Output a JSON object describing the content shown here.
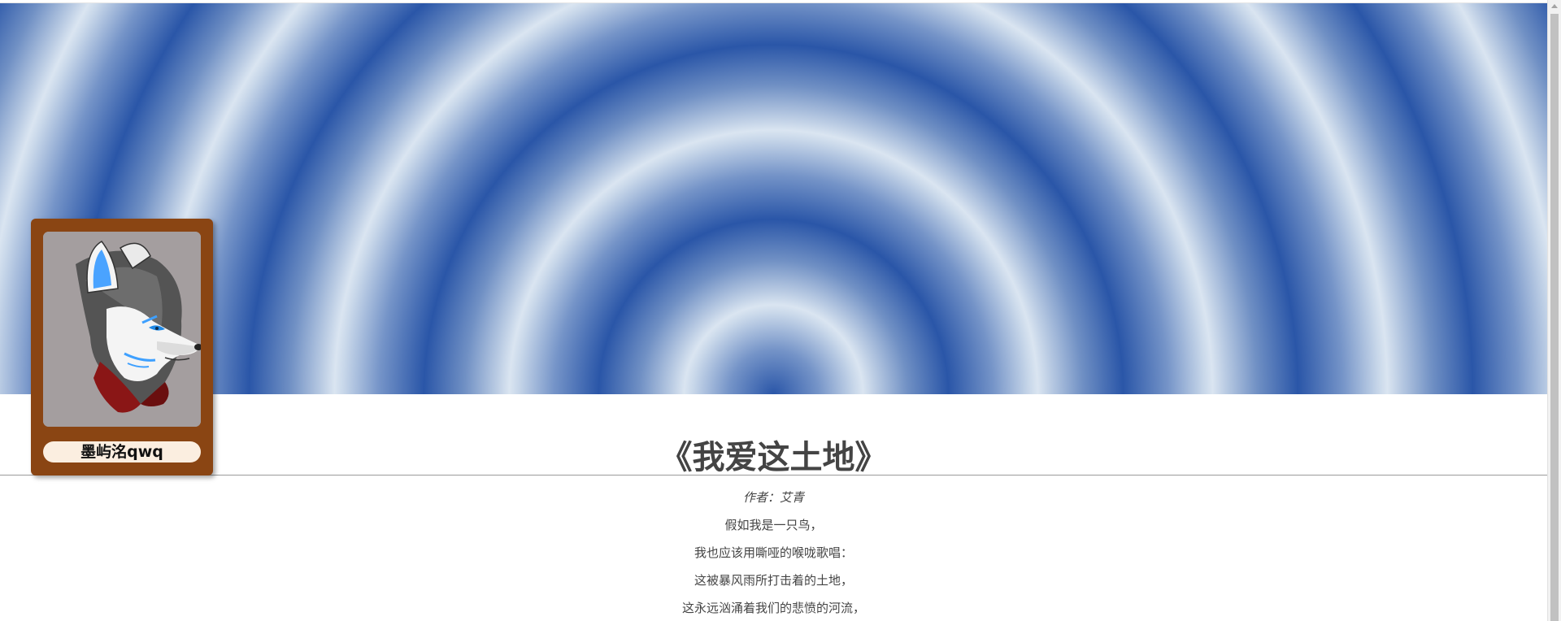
{
  "profile": {
    "name": "墨屿洺qwq",
    "avatar_icon": "hooded-wolf-avatar-icon"
  },
  "article": {
    "title": "《我爱这土地》",
    "author": "作者：艾青",
    "lines": [
      "假如我是一只鸟，",
      "我也应该用嘶哑的喉咙歌唱：",
      "这被暴风雨所打击着的土地，",
      "这永远汹涌着我们的悲愤的河流，"
    ]
  },
  "colors": {
    "banner_blue": "#2a56a8",
    "banner_light": "#dae5f1",
    "card_brown": "#8a4513",
    "name_pill": "#fbeee0",
    "text": "#444444"
  }
}
